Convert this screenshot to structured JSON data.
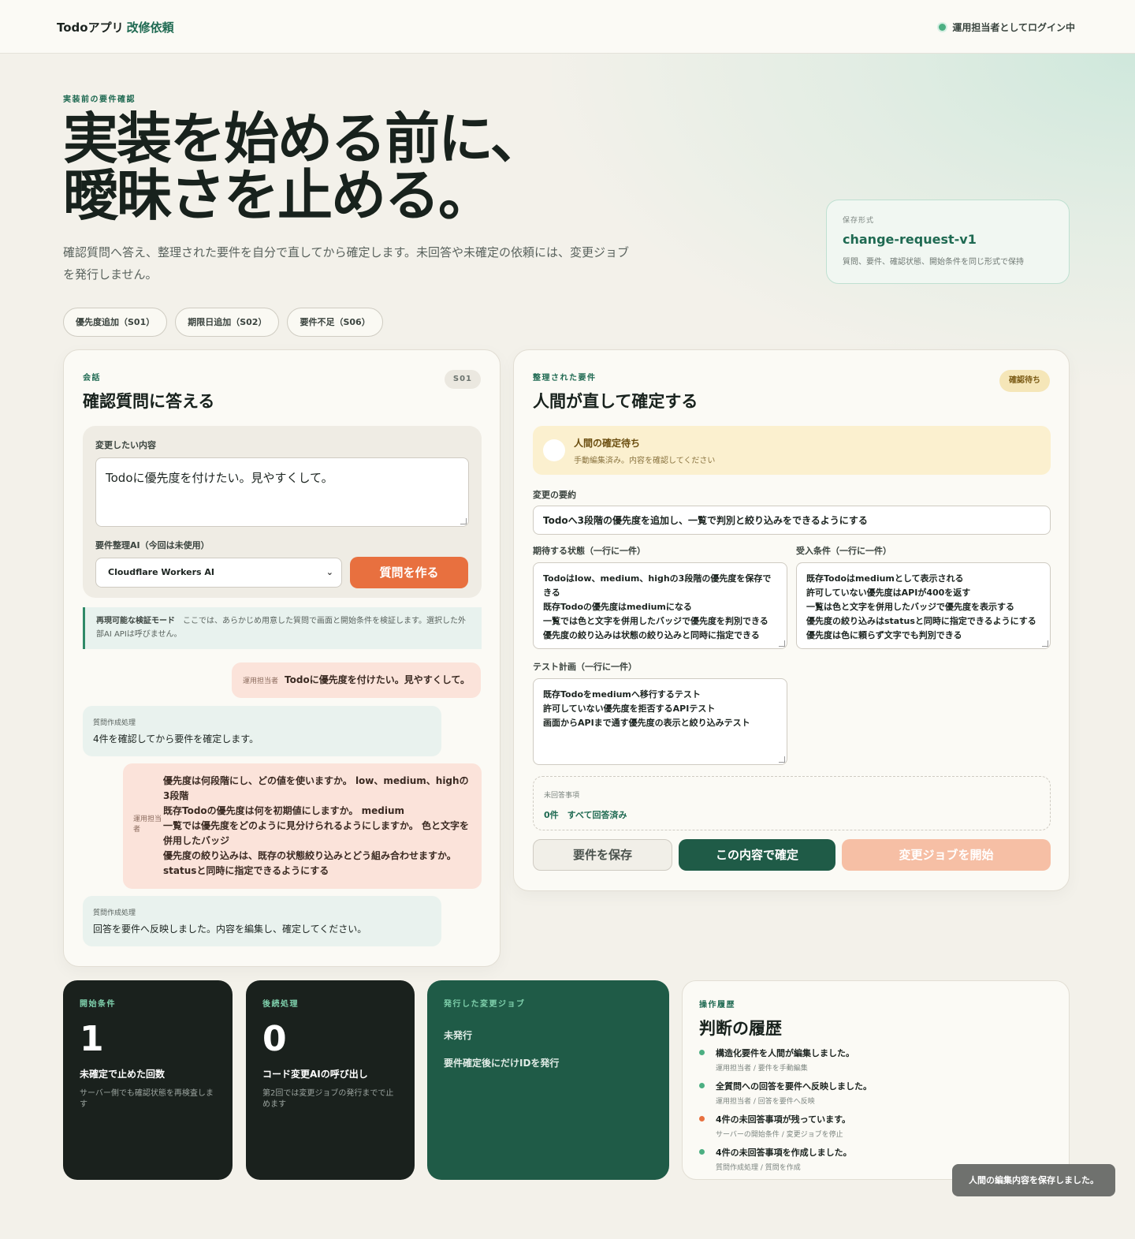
{
  "header": {
    "brand": "Todoアプリ",
    "brand_accent": "改修依頼",
    "login_status": "運用担当者としてログイン中"
  },
  "hero": {
    "eyebrow": "実装前の要件確認",
    "title_line1": "実装を始める前に、",
    "title_line2": "曖昧さを止める。",
    "description": "確認質問へ答え、整理された要件を自分で直してから確定します。未回答や未確定の依頼には、変更ジョブを発行しません。"
  },
  "save_format": {
    "label": "保存形式",
    "value": "change-request-v1",
    "description": "質問、要件、確認状態、開始条件を同じ形式で保持"
  },
  "scenarios": [
    {
      "label": "優先度追加（S01）"
    },
    {
      "label": "期限日追加（S02）"
    },
    {
      "label": "要件不足（S06）"
    }
  ],
  "conversation": {
    "eyebrow": "会話",
    "title": "確認質問に答える",
    "badge": "S01",
    "change_label": "変更したい内容",
    "change_value": "Todoに優先度を付けたい。見やすくして。",
    "ai_label": "要件整理AI（今回は未使用）",
    "ai_selected": "Cloudflare Workers AI",
    "make_questions_button": "質問を作る",
    "notice_title": "再現可能な検証モード",
    "notice_text": "ここでは、あらかじめ用意した質問で画面と開始条件を検証します。選択した外部AI APIは呼びません。",
    "user_who": "運用担当者",
    "user_message": "Todoに優先度を付けたい。見やすくして。",
    "ai1_who": "質問作成処理",
    "ai1_message": "4件を確認してから要件を確定します。",
    "qa_who": "運用担当者",
    "qa_lines": [
      "優先度は何段階にし、どの値を使いますか。 low、medium、highの3段階",
      "既存Todoの優先度は何を初期値にしますか。 medium",
      "一覧では優先度をどのように見分けられるようにしますか。 色と文字を併用したバッジ",
      "優先度の絞り込みは、既存の状態絞り込みとどう組み合わせますか。 statusと同時に指定できるようにする"
    ],
    "ai2_who": "質問作成処理",
    "ai2_message": "回答を要件へ反映しました。内容を編集し、確定してください。"
  },
  "requirements": {
    "eyebrow": "整理された要件",
    "title": "人間が直して確定する",
    "badge": "確認待ち",
    "wait_title": "人間の確定待ち",
    "wait_sub": "手動編集済み。内容を確認してください",
    "summary_label": "変更の要約",
    "summary_value": "Todoへ3段階の優先度を追加し、一覧で判別と絞り込みをできるようにする",
    "expected_label": "期待する状態（一行に一件）",
    "expected_lines": [
      "Todoはlow、medium、highの3段階の優先度を保存できる",
      "既存Todoの優先度はmediumになる",
      "一覧では色と文字を併用したバッジで優先度を判別できる",
      "優先度の絞り込みは状態の絞り込みと同時に指定できる"
    ],
    "acceptance_label": "受入条件（一行に一件）",
    "acceptance_lines": [
      "既存Todoはmediumとして表示される",
      "許可していない優先度はAPIが400を返す",
      "一覧は色と文字を併用したバッジで優先度を表示する",
      "優先度の絞り込みはstatusと同時に指定できるようにする",
      "優先度は色に頼らず文字でも判別できる"
    ],
    "test_label": "テスト計画（一行に一件）",
    "test_lines": [
      "既存Todoをmediumへ移行するテスト",
      "許可していない優先度を拒否するAPIテスト",
      "画面からAPIまで通す優先度の表示と絞り込みテスト"
    ],
    "pending_label": "未回答事項",
    "pending_value": "0件　すべて回答済み",
    "save_button": "要件を保存",
    "confirm_button": "この内容で確定",
    "start_button": "変更ジョブを開始"
  },
  "cards": {
    "start": {
      "eyebrow": "開始条件",
      "number": "1",
      "title": "未確定で止めた回数",
      "desc": "サーバー側でも確認状態を再検査します"
    },
    "after": {
      "eyebrow": "後続処理",
      "number": "0",
      "title": "コード変更AIの呼び出し",
      "desc": "第2回では変更ジョブの発行までで止めます"
    },
    "job": {
      "eyebrow": "発行した変更ジョブ",
      "status": "未発行",
      "note": "要件確定後にだけIDを発行"
    }
  },
  "history": {
    "eyebrow": "操作履歴",
    "title": "判断の履歴",
    "items": [
      {
        "title": "構造化要件を人間が編集しました。",
        "meta": "運用担当者 / 要件を手動編集"
      },
      {
        "title": "全質問への回答を要件へ反映しました。",
        "meta": "運用担当者 / 回答を要件へ反映"
      },
      {
        "title": "4件の未回答事項が残っています。",
        "meta": "サーバーの開始条件 / 変更ジョブを停止"
      },
      {
        "title": "4件の未回答事項を作成しました。",
        "meta": "質問作成処理 / 質問を作成"
      }
    ]
  },
  "toast": "人間の編集内容を保存しました。",
  "colors": {
    "accent": "#1f6a52",
    "orange": "#e8703f",
    "dark": "#1a211d",
    "wait": "#fbf0cf"
  }
}
